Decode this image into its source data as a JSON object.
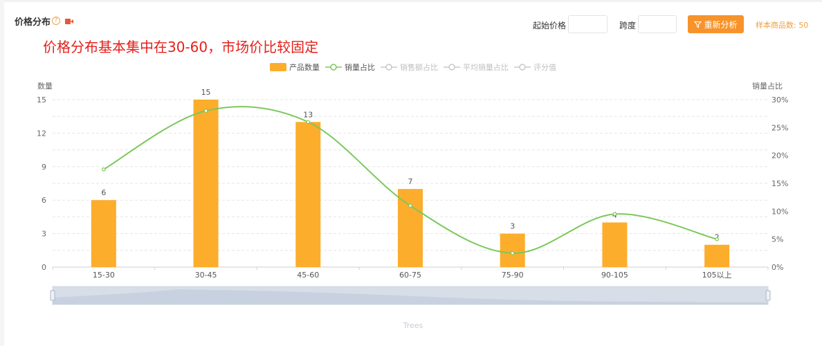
{
  "header": {
    "title": "价格分布",
    "help_glyph": "?"
  },
  "headline": "价格分布基本集中在30-60，市场价比较固定",
  "controls": {
    "start_price_label": "起始价格",
    "start_price_value": "",
    "span_label": "跨度",
    "span_value": "",
    "reanalyze_label": "重新分析",
    "sample_count_label": "样本商品数:",
    "sample_count_value": "50"
  },
  "colors": {
    "bar": "#fcad2c",
    "line": "#7bc85b",
    "headline": "#e4201b",
    "button": "#f7932b",
    "muted": "#c8c8c8"
  },
  "chart_data": {
    "type": "bar",
    "categories": [
      "15-30",
      "30-45",
      "45-60",
      "60-75",
      "75-90",
      "90-105",
      "105以上"
    ],
    "series": [
      {
        "name": "产品数量",
        "type": "bar",
        "axis": "left",
        "values": [
          6,
          15,
          13,
          7,
          3,
          4,
          2
        ]
      },
      {
        "name": "销量占比",
        "type": "line",
        "axis": "right",
        "smooth": true,
        "values": [
          17.5,
          28,
          26,
          11,
          2.5,
          9.5,
          5
        ]
      }
    ],
    "legend": {
      "placement": "top-center",
      "items": [
        {
          "name": "产品数量",
          "active": true,
          "kind": "bar"
        },
        {
          "name": "销量占比",
          "active": true,
          "kind": "line"
        },
        {
          "name": "销售额占比",
          "active": false,
          "kind": "line"
        },
        {
          "name": "平均销量占比",
          "active": false,
          "kind": "line"
        },
        {
          "name": "评分值",
          "active": false,
          "kind": "line"
        }
      ]
    },
    "ylabel_left": "数量",
    "ylabel_right": "销量占比",
    "ylim_left": [
      0,
      15
    ],
    "ylim_right": [
      0,
      30
    ],
    "yticks_left": [
      "0",
      "3",
      "6",
      "9",
      "12",
      "15"
    ],
    "yticks_right": [
      "0%",
      "5%",
      "10%",
      "15%",
      "20%",
      "25%",
      "30%"
    ],
    "grid": true,
    "datazoom_label": "Trees"
  }
}
